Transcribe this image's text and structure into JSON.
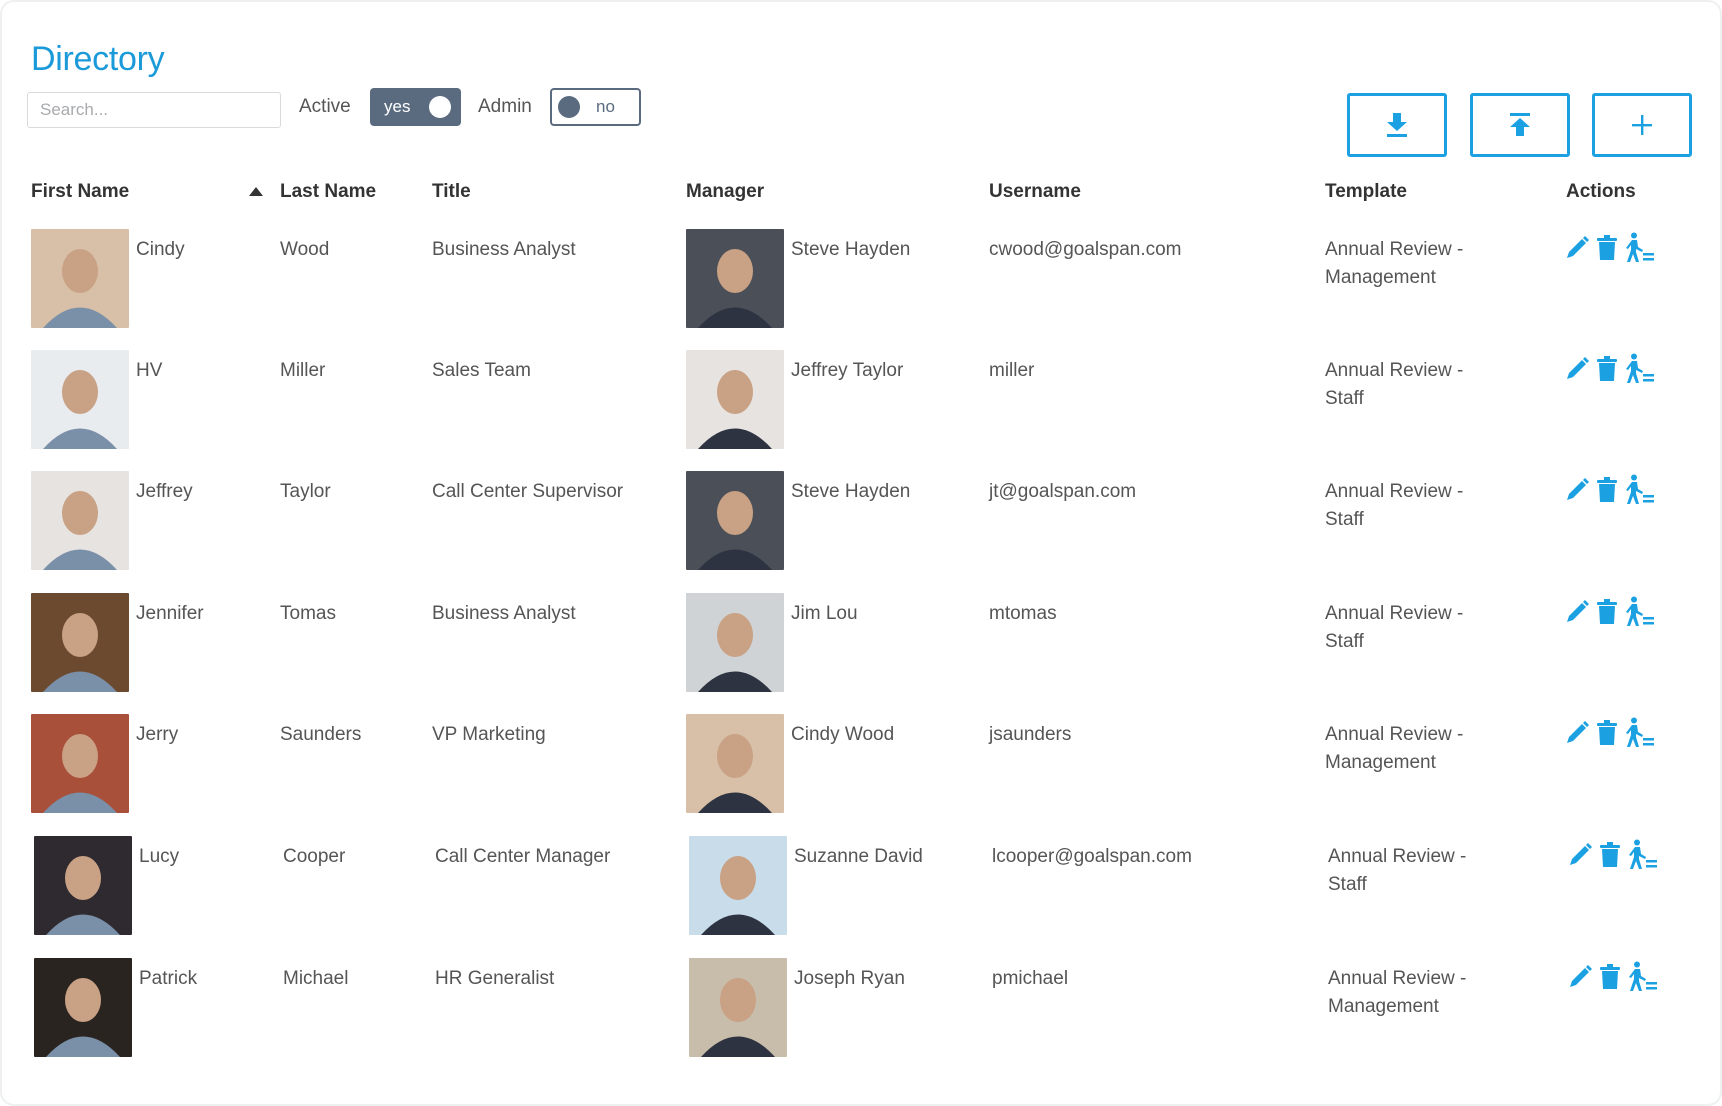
{
  "page": {
    "title": "Directory"
  },
  "filters": {
    "search_placeholder": "Search...",
    "search_value": "",
    "active_label": "Active",
    "active_value": "yes",
    "admin_label": "Admin",
    "admin_value": "no"
  },
  "toolbar": {
    "buttons": [
      {
        "name": "download-button",
        "icon": "download-icon"
      },
      {
        "name": "upload-button",
        "icon": "upload-icon"
      },
      {
        "name": "add-user-button",
        "icon": "plus-icon"
      }
    ]
  },
  "colors": {
    "accent": "#1ba1e2",
    "toggle": "#5a6b80",
    "title": "#1b9ad9"
  },
  "table": {
    "columns": [
      "First Name",
      "Last Name",
      "Title",
      "Manager",
      "Username",
      "Template",
      "Actions"
    ],
    "sorted_column": "Last Name",
    "sort_direction": "ascending",
    "rows": [
      {
        "first_name": "Cindy",
        "last_name": "Wood",
        "title": "Business Analyst",
        "manager": "Steve Hayden",
        "username": "cwood@goalspan.com",
        "template": "Annual Review - Management",
        "photo_color": "#d8c0a8",
        "manager_photo_color": "#4a4f58"
      },
      {
        "first_name": "HV",
        "last_name": "Miller",
        "title": "Sales Team",
        "manager": "Jeffrey Taylor",
        "username": "miller",
        "template": "Annual Review - Staff",
        "photo_color": "#e9ecef",
        "manager_photo_color": "#e6e3e0"
      },
      {
        "first_name": "Jeffrey",
        "last_name": "Taylor",
        "title": "Call Center Supervisor",
        "manager": "Steve Hayden",
        "username": "jt@goalspan.com",
        "template": "Annual Review - Staff",
        "photo_color": "#e6e3e0",
        "manager_photo_color": "#4a4f58"
      },
      {
        "first_name": "Jennifer",
        "last_name": "Tomas",
        "title": "Business Analyst",
        "manager": "Jim Lou",
        "username": "mtomas",
        "template": "Annual Review - Staff",
        "photo_color": "#6b4a30",
        "manager_photo_color": "#cfd3d5"
      },
      {
        "first_name": "Jerry",
        "last_name": "Saunders",
        "title": "VP Marketing",
        "manager": "Cindy Wood",
        "username": "jsaunders",
        "template": "Annual Review - Management",
        "photo_color": "#a8503a",
        "manager_photo_color": "#d8c0a8"
      },
      {
        "first_name": "Lucy",
        "last_name": "Cooper",
        "title": "Call Center Manager",
        "manager": "Suzanne David",
        "username": "lcooper@goalspan.com",
        "template": "Annual Review - Staff",
        "photo_color": "#2f2a30",
        "manager_photo_color": "#c9dcea"
      },
      {
        "first_name": "Patrick",
        "last_name": "Michael",
        "title": "HR Generalist",
        "manager": "Joseph Ryan",
        "username": "pmichael",
        "template": "Annual Review - Management",
        "photo_color": "#2a2420",
        "manager_photo_color": "#c8bcaa"
      }
    ],
    "row_actions": [
      {
        "name": "edit-button",
        "icon": "pencil-icon"
      },
      {
        "name": "delete-button",
        "icon": "trash-icon"
      },
      {
        "name": "transfer-button",
        "icon": "person-transfer-icon"
      }
    ]
  }
}
